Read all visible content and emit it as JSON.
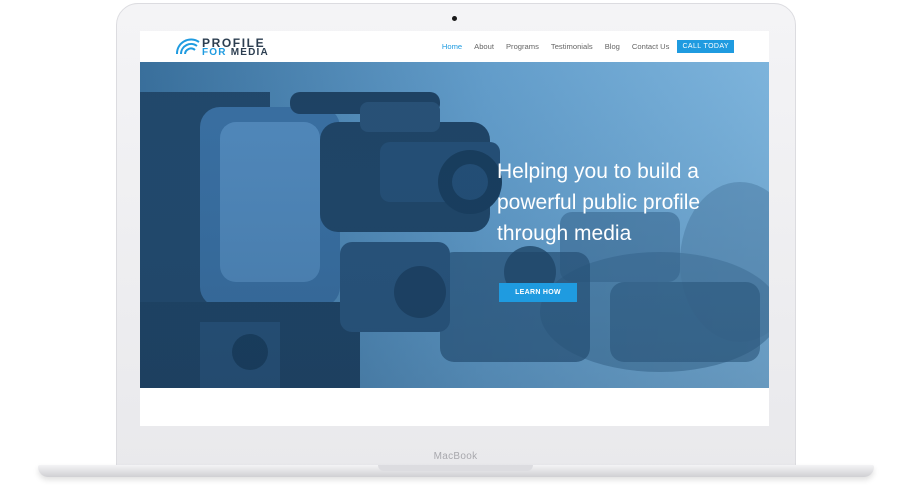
{
  "device": {
    "label": "MacBook"
  },
  "logo": {
    "line1": "PROFILE",
    "line2_accent": "FOR",
    "line2": "MEDIA"
  },
  "nav": {
    "items": [
      {
        "label": "Home",
        "active": true
      },
      {
        "label": "About"
      },
      {
        "label": "Programs"
      },
      {
        "label": "Testimonials"
      },
      {
        "label": "Blog"
      },
      {
        "label": "Contact Us"
      }
    ],
    "cta_label": "CALL TODAY"
  },
  "hero": {
    "title": "Helping you to build a powerful public profile through media",
    "button_label": "LEARN HOW"
  },
  "colors": {
    "accent": "#1f9be0",
    "overlay": "#1e6fae",
    "text_dark": "#2c3e50"
  }
}
